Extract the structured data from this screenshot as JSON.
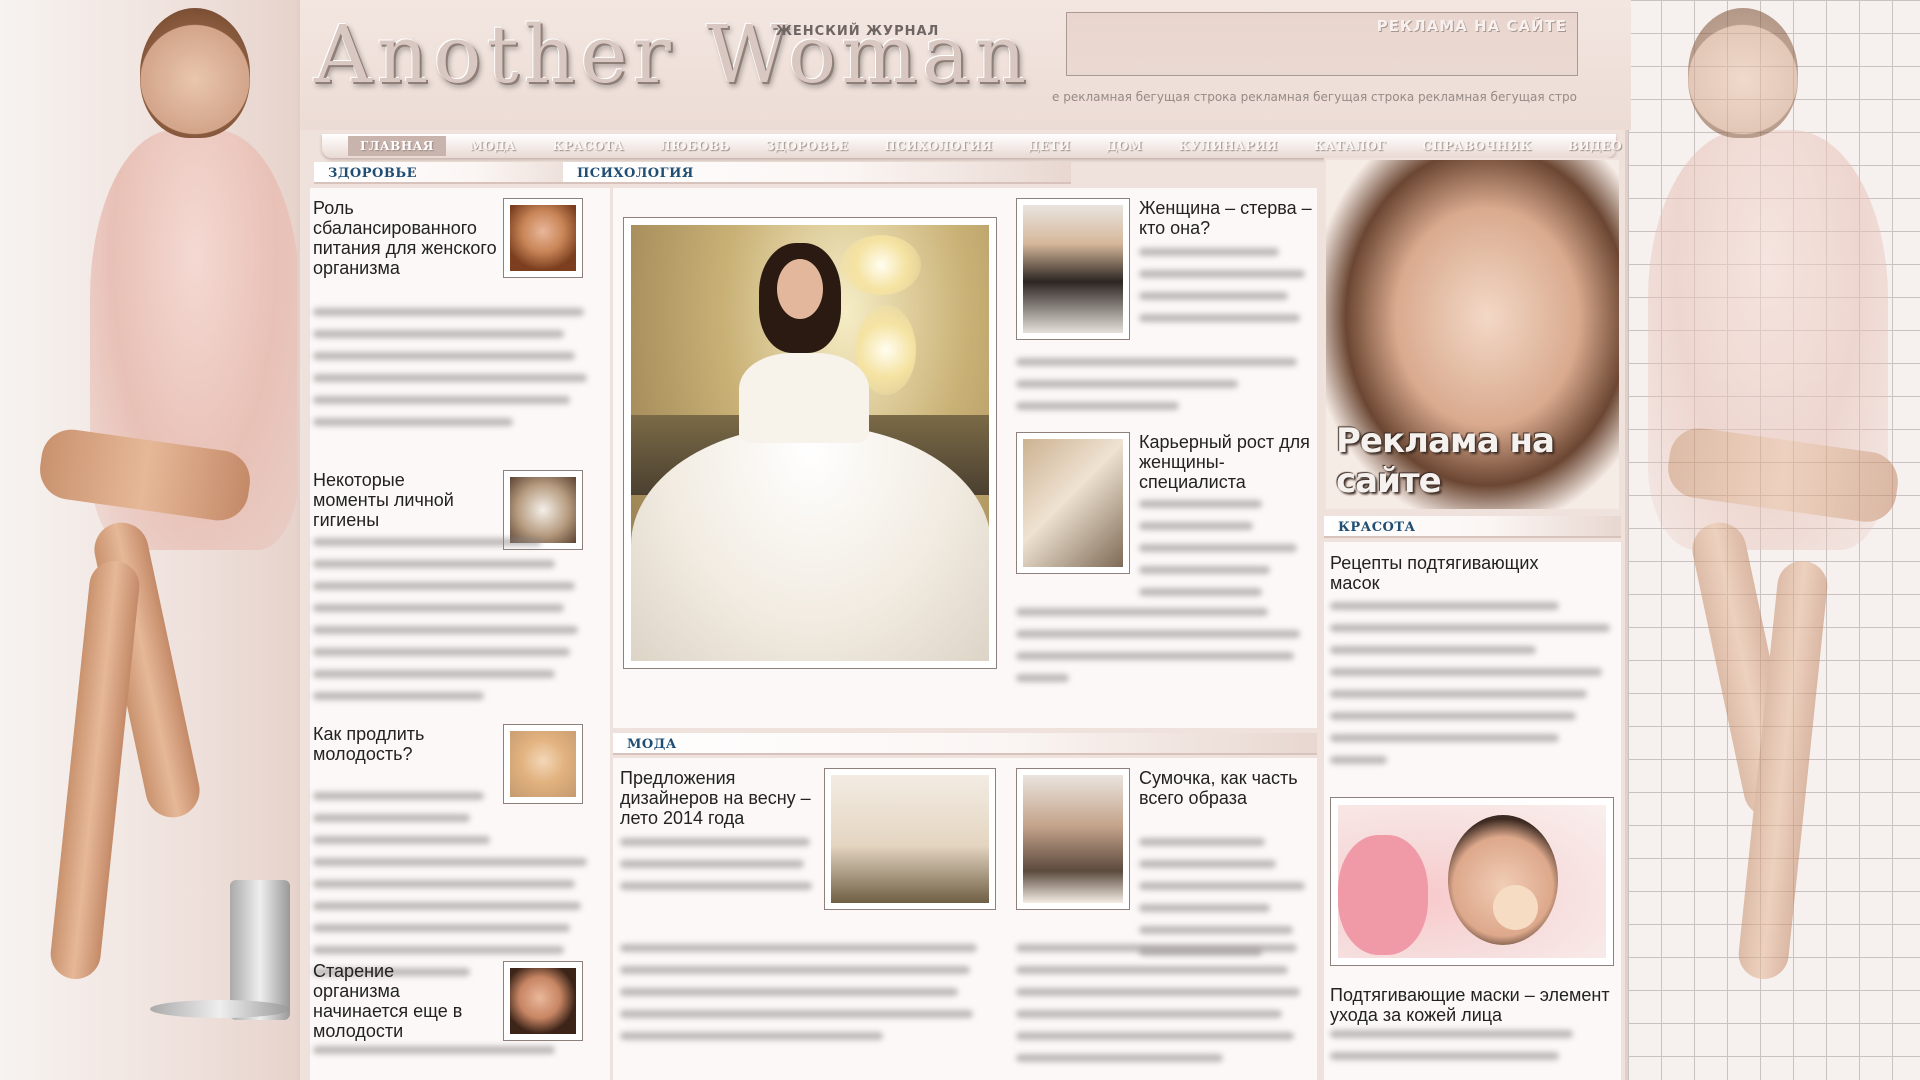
{
  "header": {
    "logo": "Another Woman",
    "tagline": "ЖЕНСКИЙ ЖУРНАЛ",
    "ad_label": "РЕКЛАМА НА САЙТЕ",
    "ticker": "е рекламная бегущая строка рекламная бегущая строка рекламная бегущая стро"
  },
  "nav": {
    "items": [
      {
        "label": "ГЛАВНАЯ"
      },
      {
        "label": "МОДА"
      },
      {
        "label": "КРАСОТА"
      },
      {
        "label": "ЛЮБОВЬ"
      },
      {
        "label": "ЗДОРОВЬЕ"
      },
      {
        "label": "ПСИХОЛОГИЯ"
      },
      {
        "label": "ДЕТИ"
      },
      {
        "label": "ДОМ"
      },
      {
        "label": "КУЛИНАРИЯ"
      },
      {
        "label": "КАТАЛОГ"
      },
      {
        "label": "СПРАВОЧНИК"
      },
      {
        "label": "ВИДЕО"
      }
    ],
    "active": "ГЛАВНАЯ"
  },
  "sections": {
    "health": "ЗДОРОВЬЕ",
    "psychology": "ПСИХОЛОГИЯ",
    "fashion": "МОДА",
    "beauty": "КРАСОТА"
  },
  "health_articles": [
    {
      "title": "Роль сбалансированного питания для женского организма"
    },
    {
      "title": "Некоторые моменты личной гигиены"
    },
    {
      "title": "Как продлить молодость?"
    },
    {
      "title": "Старение организма начинается еще в молодости"
    }
  ],
  "psychology_articles": [
    {
      "title": "Женщина – стерва – кто она?"
    },
    {
      "title": "Карьерный рост для женщины-специалиста"
    }
  ],
  "fashion_articles": [
    {
      "title": "Предложения дизайнеров на весну – лето 2014 года"
    },
    {
      "title": "Сумочка, как часть всего образа"
    }
  ],
  "beauty_articles": [
    {
      "title": "Рецепты подтягивающих масок"
    },
    {
      "title": "Подтягивающие маски – элемент ухода за кожей лица"
    }
  ],
  "right_ad": {
    "label": "Реклама на сайте"
  }
}
